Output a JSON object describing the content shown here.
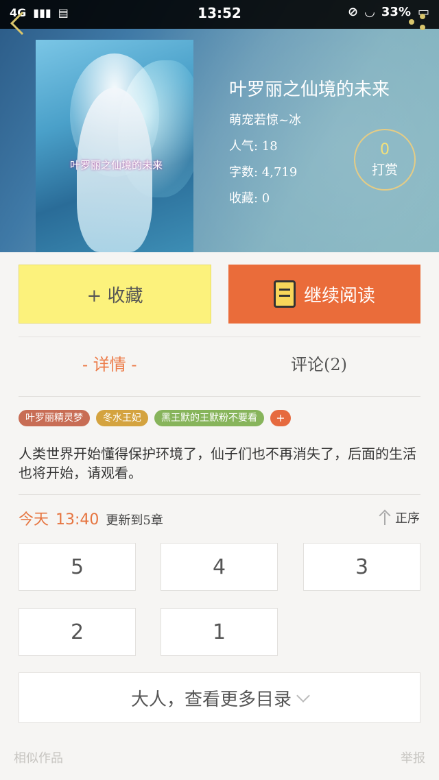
{
  "status_bar": {
    "network": "4G",
    "time": "13:52",
    "battery": "33%"
  },
  "book": {
    "title": "叶罗丽之仙境的未来",
    "author": "萌宠若惊~冰",
    "popularity_label": "人气",
    "popularity_value": "18",
    "word_count_label": "字数",
    "word_count_value": "4,719",
    "favorites_label": "收藏",
    "favorites_value": "0",
    "cover_text": "叶罗丽之仙境的未来"
  },
  "reward": {
    "count": "0",
    "label": "打赏"
  },
  "actions": {
    "collect_label": "+ 收藏",
    "read_label": "继续阅读"
  },
  "tabs": {
    "details": "- 详情 -",
    "comments": "评论(2)"
  },
  "tags": [
    "叶罗丽精灵梦",
    "冬水王妃",
    "黑王默的王默粉不要看"
  ],
  "tag_add": "+",
  "description": "人类世界开始懂得保护环境了，仙子们也不再消失了，后面的生活也将开始，请观看。",
  "update": {
    "day": "今天",
    "time": "13:40",
    "info": "更新到5章"
  },
  "sort_label": "正序",
  "chapters": [
    "5",
    "4",
    "3",
    "2",
    "1"
  ],
  "more_catalog": "大人，查看更多目录",
  "footer": {
    "similar": "相似作品",
    "report": "举报"
  },
  "colors": {
    "accent_orange": "#ea6c3a",
    "collect_yellow": "#fcf27c",
    "reward_gold": "#e5cc85"
  }
}
